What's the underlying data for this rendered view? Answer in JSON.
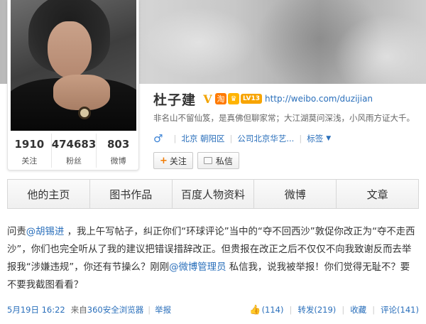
{
  "profile": {
    "name": "杜子建",
    "verified_mark": "V",
    "tao_icon": "淘",
    "crown_icon": "♛",
    "level_badge": "LV13",
    "url": "http://weibo.com/duzijian",
    "bio": "非名山不留仙笈，是真佛但聊家常；大江湖莫问深浅，小风雨方证大千。",
    "gender_icon": "♂",
    "location": "北京 朝阳区",
    "company": "公司北京华艺...",
    "tags_label": "标签",
    "follow_label": "关注",
    "message_label": "私信",
    "stats": [
      {
        "count": "1910",
        "label": "关注"
      },
      {
        "count": "474683",
        "label": "粉丝"
      },
      {
        "count": "803",
        "label": "微博"
      }
    ]
  },
  "nav": {
    "tabs": [
      "他的主页",
      "图书作品",
      "百度人物资料",
      "微博",
      "文章"
    ]
  },
  "post": {
    "p1": "问责",
    "mention1": "@胡锡进",
    "p2": " ，我上午写帖子，纠正你们“环球评论”当中的“夺不回西沙”敦促你改正为“夺不走西沙”，你们也完全听从了我的建议把错误措辞改正。但贵报在改正之后不仅仅不向我致谢反而去举报我“涉嫌违规”，你还有节操么？刚刚",
    "mention2": "@微博管理员",
    "p3": " 私信我，说我被举报！你们觉得无耻不？要不要我截图看看？",
    "time": "5月19日 16:22",
    "source_prefix": "来自",
    "source": "360安全浏览器",
    "report": "举报",
    "likes": "(114)",
    "repost": "转发(219)",
    "favorite": "收藏",
    "comment": "评论(141)"
  },
  "icons": {
    "avatar": "profile-photo",
    "gender": "male-icon",
    "like": "thumbs-up-icon",
    "message": "envelope-icon"
  },
  "colors": {
    "link": "#2a6fbb",
    "accent_orange": "#f07a00",
    "badge_gold": "#f7a400"
  }
}
